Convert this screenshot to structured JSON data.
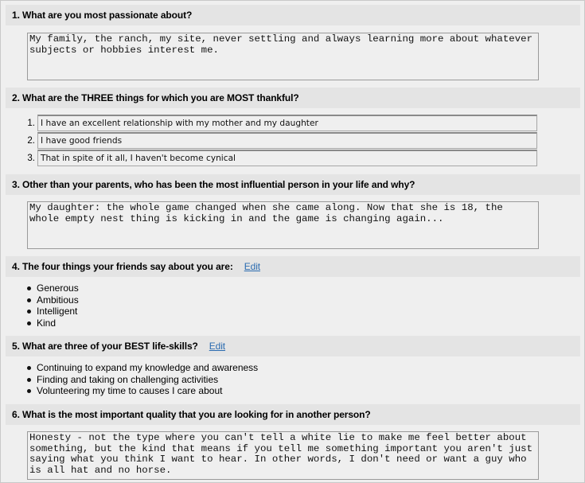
{
  "questions": [
    {
      "number": "1.",
      "title": "1. What are you most passionate about?",
      "type": "textarea",
      "answer": "My family, the ranch, my site, never settling and always learning more about whatever subjects or hobbies interest me."
    },
    {
      "number": "2.",
      "title": "2. What are the THREE things for which you are MOST thankful?",
      "type": "numbered-fields",
      "items": [
        {
          "num": "1.",
          "value": "I have an excellent relationship with my mother and my daughter"
        },
        {
          "num": "2.",
          "value": "I have good friends"
        },
        {
          "num": "3.",
          "value": "That in spite of it all, I haven't become cynical"
        }
      ]
    },
    {
      "number": "3.",
      "title": "3. Other than your parents, who has been the most influential person in your life and why?",
      "type": "textarea",
      "answer": "My daughter: the whole game changed when she came along. Now that she is 18, the whole empty nest thing is kicking in and the game is changing again..."
    },
    {
      "number": "4.",
      "title": "4. The four things your friends say about you are:",
      "edit_label": "Edit",
      "type": "bullets",
      "items": [
        "Generous",
        "Ambitious",
        "Intelligent",
        "Kind"
      ]
    },
    {
      "number": "5.",
      "title": "5. What are three of your BEST life-skills?",
      "edit_label": "Edit",
      "type": "bullets",
      "items": [
        "Continuing to expand my knowledge and awareness",
        "Finding and taking on challenging activities",
        "Volunteering my time to causes I care about"
      ]
    },
    {
      "number": "6.",
      "title": "6. What is the most important quality that you are looking for in another person?",
      "type": "textarea",
      "answer": "Honesty - not the type where you can't tell a white lie to make me feel better about something, but the kind that means if you tell me something important you aren't just saying what you think I want to hear. In other words, I don't need or want a guy who is all hat and no horse."
    }
  ],
  "colors": {
    "page_bg": "#efefef",
    "header_bg": "#e4e4e4",
    "link": "#2a6bb0",
    "border": "#9a9a9a"
  }
}
